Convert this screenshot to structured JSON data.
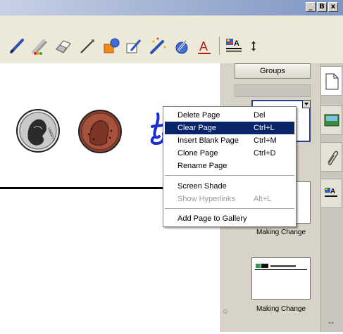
{
  "window": {
    "controls": {
      "minimize": "_",
      "maximize": "B",
      "close": "x"
    }
  },
  "toolbar": {
    "tools": [
      {
        "name": "pen-tool-icon"
      },
      {
        "name": "creative-pen-icon"
      },
      {
        "name": "eraser-icon"
      },
      {
        "name": "line-tool-icon"
      },
      {
        "name": "shape-tool-icon"
      },
      {
        "name": "fill-tool-icon"
      },
      {
        "name": "magic-pen-icon"
      },
      {
        "name": "shape-recognition-icon"
      },
      {
        "name": "text-tool-icon"
      },
      {
        "name": "table-tool-icon"
      },
      {
        "name": "move-toolbar-icon"
      }
    ],
    "text_tool_letter": "A",
    "table_tool_letter": "A"
  },
  "canvas": {
    "coins": [
      "nickel",
      "penny"
    ]
  },
  "sidepanel": {
    "groups_button": "Groups",
    "thumbnails": [
      {
        "label": "Making Change"
      },
      {
        "label": "Making Change"
      }
    ]
  },
  "tabs": [
    {
      "name": "page-sorter-tab",
      "active": true
    },
    {
      "name": "gallery-tab",
      "active": false
    },
    {
      "name": "attachments-tab",
      "active": false
    },
    {
      "name": "properties-tab",
      "active": false
    }
  ],
  "context_menu": {
    "items": [
      {
        "label": "Delete Page",
        "shortcut": "Del",
        "state": "normal"
      },
      {
        "label": "Clear Page",
        "shortcut": "Ctrl+L",
        "state": "highlighted"
      },
      {
        "label": "Insert Blank Page",
        "shortcut": "Ctrl+M",
        "state": "normal"
      },
      {
        "label": "Clone Page",
        "shortcut": "Ctrl+D",
        "state": "normal"
      },
      {
        "label": "Rename Page",
        "shortcut": "",
        "state": "normal"
      },
      {
        "label": "Screen Shade",
        "shortcut": "",
        "state": "normal"
      },
      {
        "label": "Show Hyperlinks",
        "shortcut": "Alt+L",
        "state": "disabled"
      },
      {
        "label": "Add Page to Gallery",
        "shortcut": "",
        "state": "normal"
      }
    ]
  },
  "colors": {
    "highlight": "#0a246a",
    "ink_blue": "#1a2ecf",
    "titlebar_blue": "#7f96c4"
  }
}
